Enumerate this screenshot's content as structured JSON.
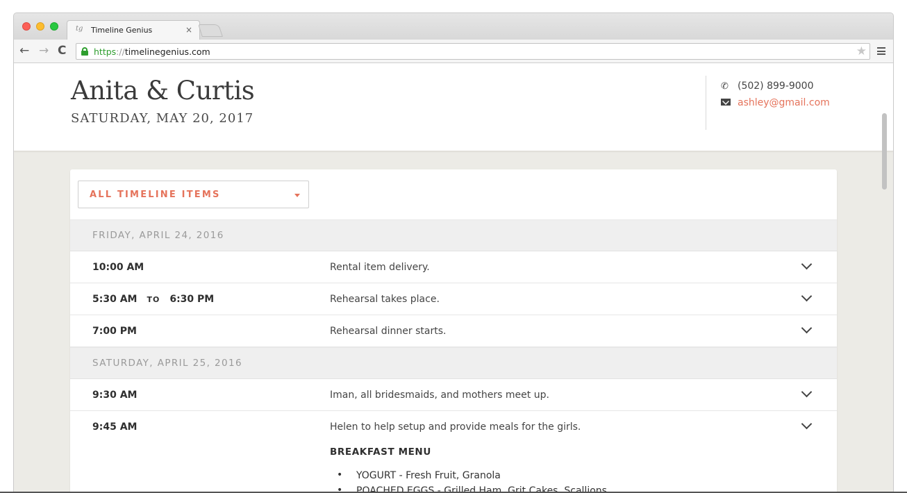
{
  "browser": {
    "tab_title": "Timeline Genius",
    "tab_favicon": "tg",
    "tab_close": "×",
    "url_scheme": "https",
    "url_sep": "://",
    "url_host": "timelinegenius.com",
    "icons": {
      "back": "←",
      "forward": "→",
      "reload": "C",
      "star": "★"
    }
  },
  "header": {
    "couple": "Anita & Curtis",
    "date": "SATURDAY, MAY 20, 2017",
    "phone": "(502) 899-9000",
    "email": "ashley@gmail.com",
    "phone_icon": "✆"
  },
  "filter": {
    "label": "ALL TIMELINE ITEMS"
  },
  "days": [
    {
      "label": "FRIDAY, APRIL 24, 2016",
      "items": [
        {
          "time": "10:00 AM",
          "desc": "Rental item delivery."
        },
        {
          "start": "5:30 AM",
          "to": "TO",
          "end": "6:30 PM",
          "desc": "Rehearsal takes place."
        },
        {
          "time": "7:00 PM",
          "desc": "Rehearsal dinner starts."
        }
      ]
    },
    {
      "label": "SATURDAY, APRIL 25, 2016",
      "items": [
        {
          "time": "9:30 AM",
          "desc": "Iman, all bridesmaids, and mothers meet up."
        },
        {
          "time": "9:45 AM",
          "desc": "Helen to help setup and provide meals for the girls."
        }
      ]
    }
  ],
  "breakfast_menu": {
    "title": "BREAKFAST MENU",
    "items": [
      "YOGURT - Fresh Fruit, Granola",
      "POACHED EGGS - Grilled Ham, Grit Cakes, Scallions"
    ]
  },
  "colors": {
    "accent": "#e5735b",
    "secure": "#2e9e2e",
    "day_header_bg": "#efefef"
  }
}
